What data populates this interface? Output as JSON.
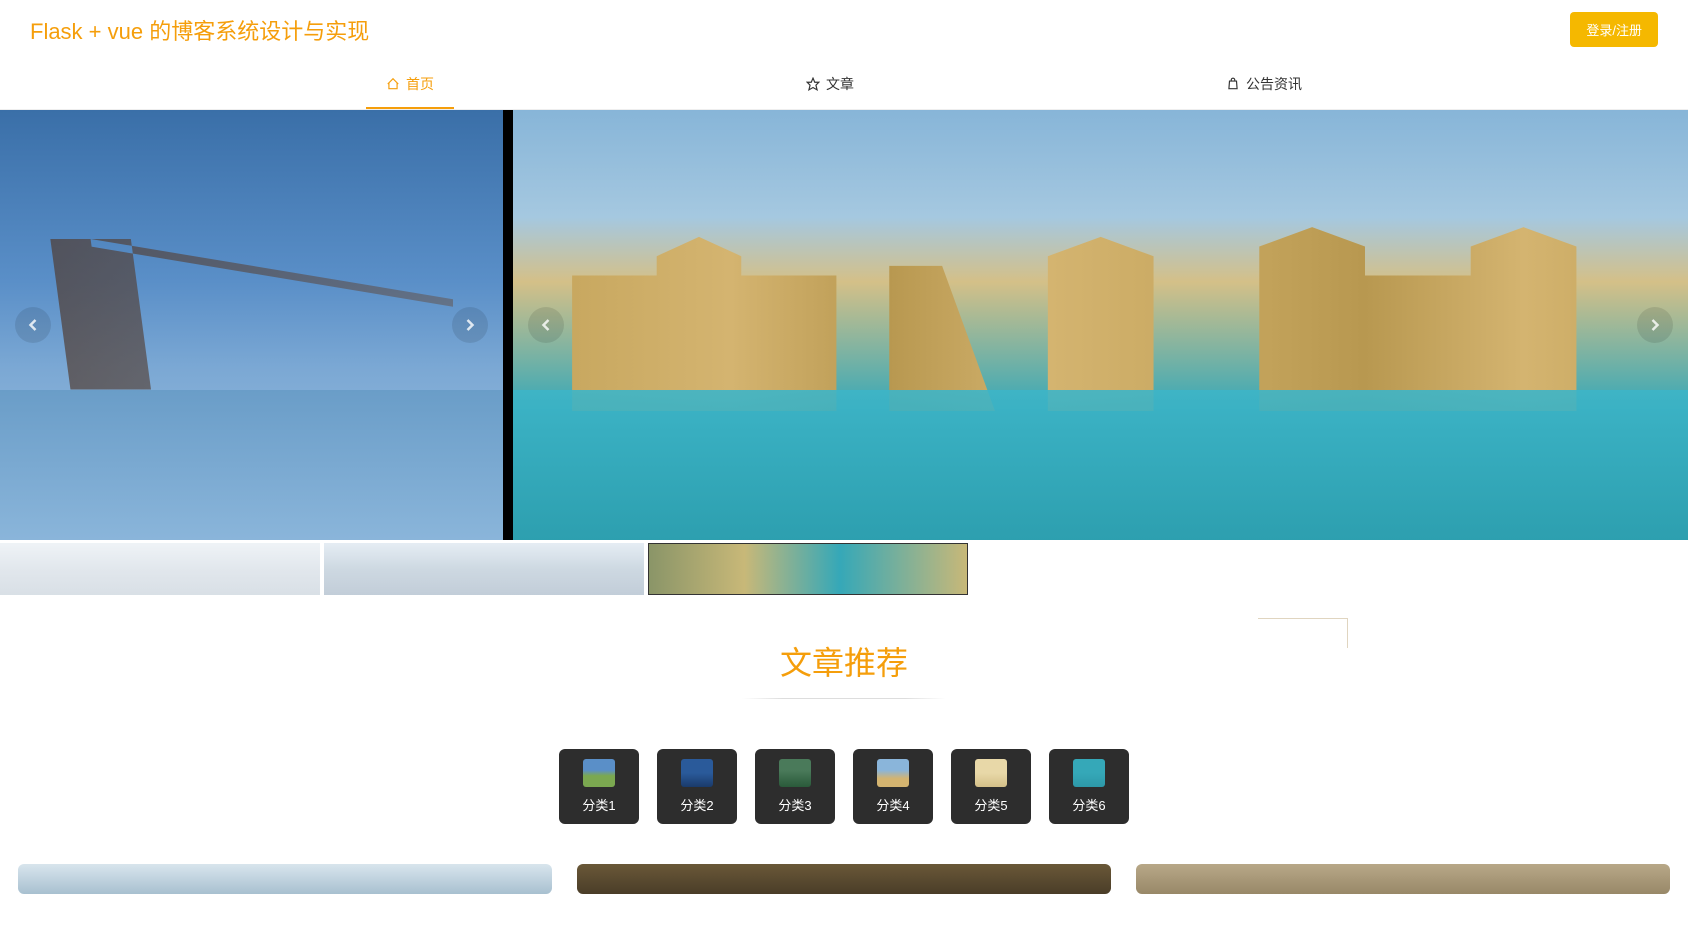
{
  "header": {
    "site_title": "Flask + vue 的博客系统设计与实现",
    "login_button": "登录/注册"
  },
  "nav": {
    "tabs": [
      {
        "label": "首页",
        "icon": "home-icon",
        "active": true
      },
      {
        "label": "文章",
        "icon": "star-icon",
        "active": false
      },
      {
        "label": "公告资讯",
        "icon": "bag-icon",
        "active": false
      }
    ]
  },
  "carousel": {
    "left_alt": "Brooklyn Bridge cityscape",
    "main_alt": "Yellow palace with pool",
    "thumbnails": [
      {
        "alt": "thumbnail-1",
        "active": false
      },
      {
        "alt": "thumbnail-2",
        "active": false
      },
      {
        "alt": "thumbnail-3",
        "active": true
      }
    ]
  },
  "section": {
    "title": "文章推荐"
  },
  "categories": [
    {
      "label": "分类1"
    },
    {
      "label": "分类2"
    },
    {
      "label": "分类3"
    },
    {
      "label": "分类4"
    },
    {
      "label": "分类5"
    },
    {
      "label": "分类6"
    }
  ],
  "articles": [
    {
      "alt": "article-1"
    },
    {
      "alt": "article-2"
    },
    {
      "alt": "article-3"
    }
  ]
}
